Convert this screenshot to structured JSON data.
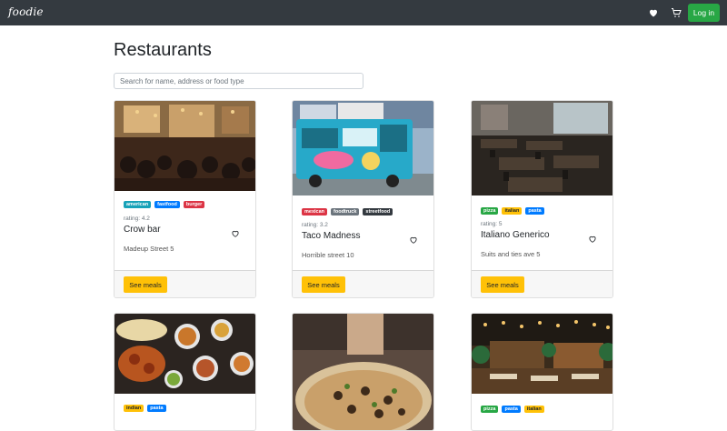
{
  "navbar": {
    "brand": "foodie",
    "favorites_icon": "heart-icon",
    "cart_icon": "cart-icon",
    "login_label": "Log in",
    "login_color": "#28a745",
    "background": "#343a40"
  },
  "page": {
    "title": "Restaurants",
    "search_placeholder": "Search for name, address or food type"
  },
  "tag_colors": {
    "american": "#17a2b8",
    "fastfood": "#007bff",
    "burger": "#dc3545",
    "mexican": "#dc3545",
    "foodtruck": "#6c757d",
    "streetfood": "#343a40",
    "pizza": "#28a745",
    "italian": "#ffc107",
    "pasta": "#007bff",
    "indian": "#ffc107"
  },
  "restaurants": [
    {
      "tags": [
        "american",
        "fastfood",
        "burger"
      ],
      "rating_text": "rating: 4.2",
      "name": "Crow bar",
      "address": "Madeup Street 5",
      "button_label": "See meals",
      "image": "bar-interior-photo"
    },
    {
      "tags": [
        "mexican",
        "foodtruck",
        "streetfood"
      ],
      "rating_text": "rating: 3.2",
      "name": "Taco Madness",
      "address": "Horrible street 10",
      "button_label": "See meals",
      "image": "food-truck-photo"
    },
    {
      "tags": [
        "pizza",
        "italian",
        "pasta"
      ],
      "rating_text": "rating: 5",
      "name": "Italiano Generico",
      "address": "Suits and ties ave 5",
      "button_label": "See meals",
      "image": "restaurant-tables-photo"
    },
    {
      "tags": [
        "indian",
        "pasta"
      ],
      "image": "indian-dishes-photo"
    },
    {
      "tags": [],
      "image": "pizza-photo"
    },
    {
      "tags": [
        "pizza",
        "pasta",
        "italian"
      ],
      "image": "terrace-restaurant-photo"
    }
  ]
}
